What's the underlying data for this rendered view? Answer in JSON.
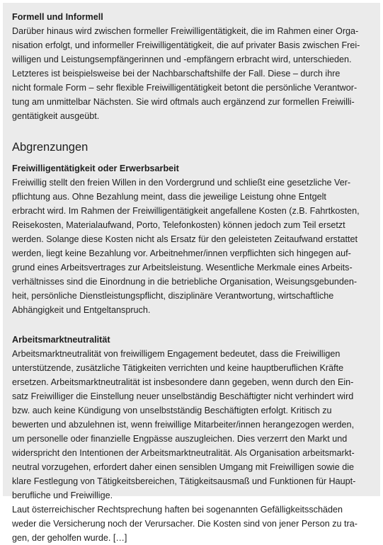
{
  "section1": {
    "heading": "Formell und Informell",
    "lines": [
      "Darüber hinaus wird zwischen formeller Freiwilligentätigkeit, die im Rahmen einer Orga-",
      "nisation erfolgt, und informeller Freiwilligentätigkeit, die auf privater Basis zwischen Frei-",
      "willigen und Leistungsempfängerinnen und -empfängern erbracht wird, unterschieden.",
      "Letzteres ist beispielsweise bei der Nachbarschaftshilfe der Fall. Diese – durch ihre",
      "nicht formale Form – sehr flexible Freiwilligentätigkeit betont die persönliche Verantwor-",
      "tung am unmittelbar Nächsten. Sie wird oftmals auch ergänzend zur formellen Freiwilli-",
      "gentätigkeit ausgeübt."
    ]
  },
  "section2": {
    "heading": "Abgrenzungen"
  },
  "section3": {
    "heading": "Freiwilligentätigkeit oder Erwerbsarbeit",
    "lines": [
      "Freiwillig stellt den freien Willen in den Vordergrund und schließt eine gesetzliche Ver-",
      "pflichtung aus. Ohne Bezahlung meint, dass die jeweilige Leistung ohne Entgelt",
      "erbracht wird. Im Rahmen der Freiwilligentätigkeit angefallene Kosten (z.B. Fahrtkosten,",
      "Reisekosten, Materialaufwand, Porto, Telefonkosten) können jedoch zum Teil ersetzt",
      "werden. Solange diese Kosten nicht als Ersatz für den geleisteten Zeitaufwand erstattet",
      "werden, liegt keine Bezahlung vor. Arbeitnehmer/innen verpflichten sich hingegen auf-",
      "grund eines Arbeitsvertrages zur Arbeitsleistung. Wesentliche Merkmale eines Arbeits-",
      "verhältnisses sind die Einordnung in die betriebliche Organisation, Weisungsgebunden-",
      "heit, persönliche Dienstleistungspflicht, disziplinäre Verantwortung, wirtschaftliche",
      "Abhängigkeit und Entgeltanspruch."
    ]
  },
  "section4": {
    "heading": "Arbeitsmarktneutralität",
    "lines": [
      "Arbeitsmarktneutralität von freiwilligem Engagement bedeutet, dass die Freiwilligen",
      "unterstützende, zusätzliche Tätigkeiten verrichten und keine hauptberuflichen Kräfte",
      "ersetzen. Arbeitsmarktneutralität ist insbesondere dann gegeben, wenn durch den Ein-",
      "satz Freiwilliger die Einstellung neuer unselbständig Beschäftigter nicht verhindert wird",
      "bzw. auch keine Kündigung von unselbstständig Beschäftigten erfolgt. Kritisch zu",
      "bewerten und abzulehnen ist, wenn freiwillige Mitarbeiter/innen herangezogen werden,",
      "um personelle oder finanzielle Engpässe auszugleichen. Dies verzerrt den Markt und",
      "widerspricht den Intentionen der Arbeitsmarktneutralität. Als Organisation arbeitsmarkt-",
      "neutral vorzugehen, erfordert daher einen sensiblen Umgang mit Freiwilligen sowie die",
      "klare Festlegung von Tätigkeitsbereichen, Tätigkeitsausmaß und Funktionen für Haupt-",
      "berufliche und Freiwillige.",
      "Laut österreichischer Rechtsprechung haften bei sogenannten Gefälligkeitsschäden",
      "weder die Versicherung noch der Verursacher. Die Kosten sind von jener Person zu tra-",
      "gen, der geholfen wurde. […]"
    ]
  }
}
